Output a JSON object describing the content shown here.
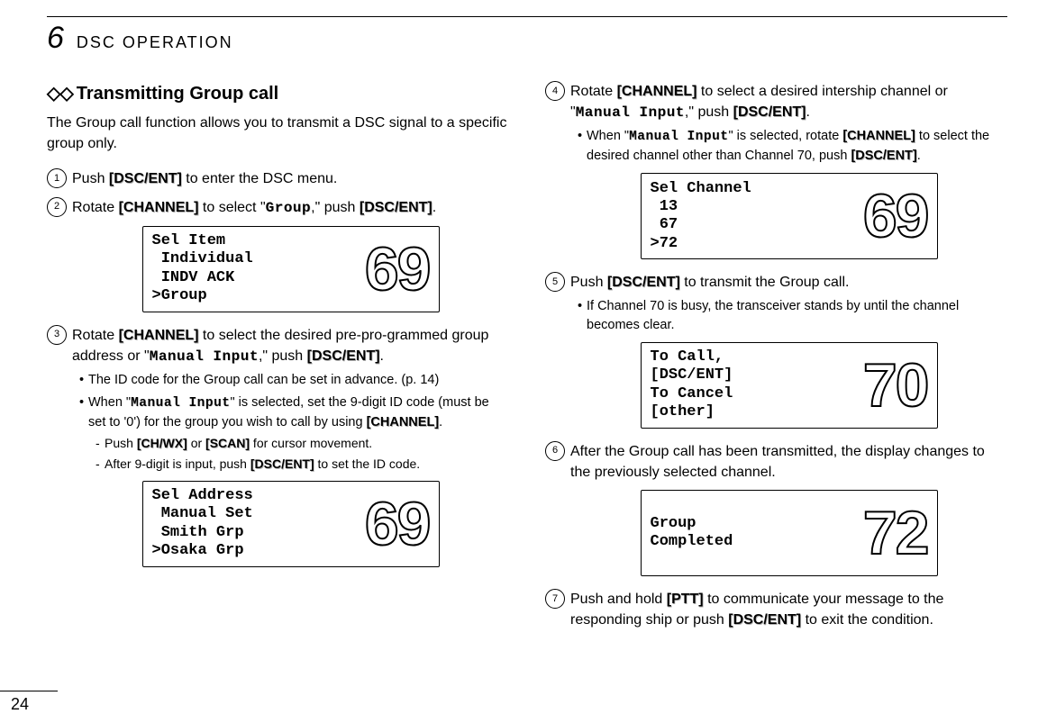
{
  "header": {
    "chapter_number": "6",
    "chapter_title": "DSC OPERATION"
  },
  "section": {
    "diamond": "◇◇",
    "title": "Transmitting Group call",
    "intro": "The Group call function allows you to transmit a DSC signal to a specific group only."
  },
  "buttons": {
    "dsc_ent": "[DSC/ENT]",
    "channel": "[CHANNEL]",
    "ch_wx": "[CH/WX]",
    "scan": "[SCAN]",
    "ptt": "[PTT]"
  },
  "mono": {
    "group": "Group",
    "manual_input": "Manual Input"
  },
  "steps_left": {
    "s1": {
      "num": "1",
      "t1": "Push ",
      "t2": " to enter the DSC menu."
    },
    "s2": {
      "num": "2",
      "t1": "Rotate ",
      "t2": " to select \"",
      "t3": ",\" push ",
      "t4": "."
    },
    "s3": {
      "num": "3",
      "t1": "Rotate ",
      "t2": " to select the desired pre-pro-grammed group address or \"",
      "t3": ",\" push ",
      "t4": ".",
      "note1": "The ID code for the Group call can be set in advance. (p. 14)",
      "note2a": "When \"",
      "note2b": "\" is selected, set the 9-digit ID code (must be set to '0') for the group you wish to call by using ",
      "note2c": ".",
      "note3a": "Push ",
      "note3b": " or ",
      "note3c": " for cursor movement.",
      "note4a": "After 9-digit is input, push ",
      "note4b": " to set the ID code."
    }
  },
  "steps_right": {
    "s4": {
      "num": "4",
      "t1": "Rotate ",
      "t2": " to select a desired intership channel or \"",
      "t3": ",\" push ",
      "t4": ".",
      "note1a": "When \"",
      "note1b": "\" is selected, rotate ",
      "note1c": " to select the desired channel other than Channel 70, push ",
      "note1d": "."
    },
    "s5": {
      "num": "5",
      "t1": "Push ",
      "t2": " to transmit the Group call.",
      "note1": "If Channel 70 is busy, the transceiver stands by until the channel becomes clear."
    },
    "s6": {
      "num": "6",
      "t1": "After the Group call has been transmitted, the display changes to the previously selected channel."
    },
    "s7": {
      "num": "7",
      "t1": "Push and hold ",
      "t2": " to communicate your message to the responding ship or push ",
      "t3": " to exit the condition."
    }
  },
  "displays": {
    "d1": {
      "lines": "Sel Item\n Individual\n INDV ACK\n˃Group",
      "num": "69"
    },
    "d2": {
      "lines": "Sel Address\n Manual Set\n Smith Grp\n˃Osaka Grp",
      "num": "69"
    },
    "d3": {
      "lines": "Sel Channel\n 13\n 67\n˃72",
      "num": "69"
    },
    "d4": {
      "lines": "To Call,\n[DSC/ENT]\nTo Cancel\n[other]",
      "num": "70"
    },
    "d5": {
      "lines": "Group\nCompleted",
      "num": "72"
    }
  },
  "page_number": "24"
}
